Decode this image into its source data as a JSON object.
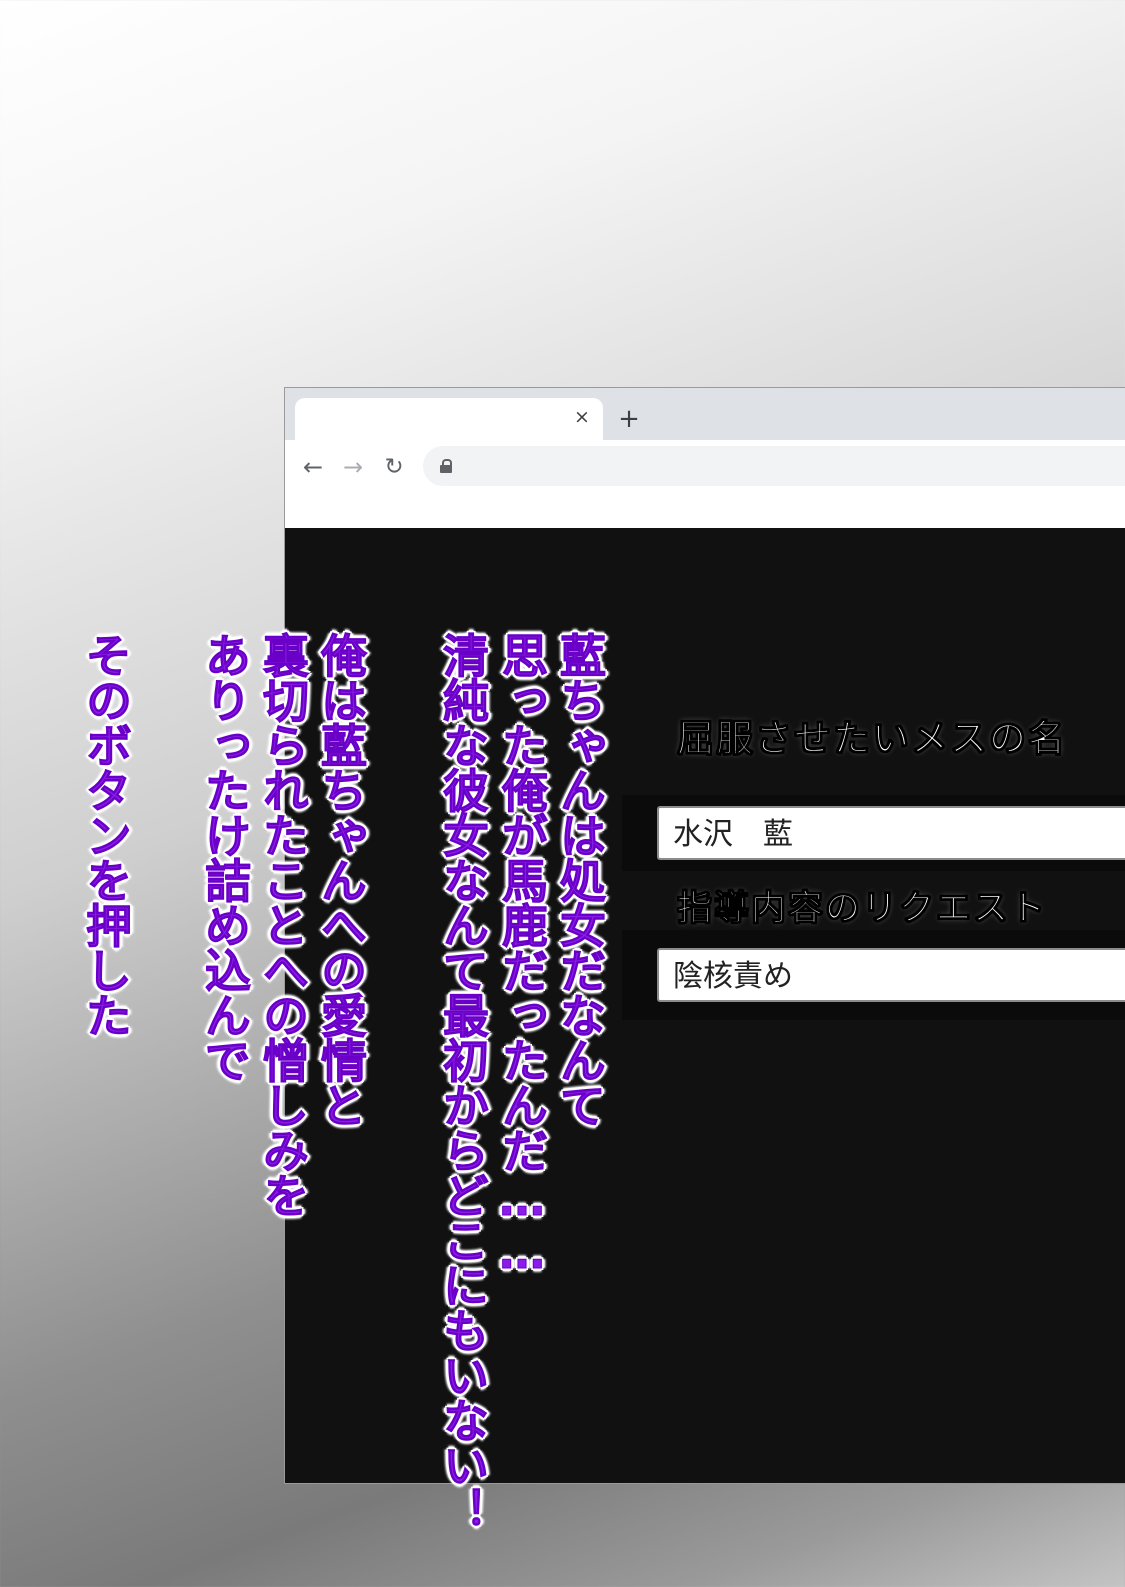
{
  "browser": {
    "tab_close_icon": "close-icon",
    "tab_close_glyph": "×",
    "new_tab_icon": "plus-icon",
    "new_tab_glyph": "+",
    "nav_back_glyph": "←",
    "nav_forward_glyph": "→",
    "nav_reload_glyph": "↻",
    "address_icon": "lock-icon"
  },
  "form": {
    "name_label": "屈服させたいメスの名",
    "name_value": "水沢　藍",
    "request_label": "指導内容のリクエスト",
    "request_value": "陰核責め"
  },
  "narration": {
    "lines": [
      "藍ちゃんは処女だなんて",
      "思った俺が馬鹿だったんだ……",
      "清純な彼女なんて最初からどこにもいない！",
      "俺は藍ちゃんへの愛情と",
      "裏切られたことへの憎しみを",
      "ありったけ詰め込んで",
      "そのボタンを押した"
    ],
    "text_color": "#8a1ee6"
  }
}
